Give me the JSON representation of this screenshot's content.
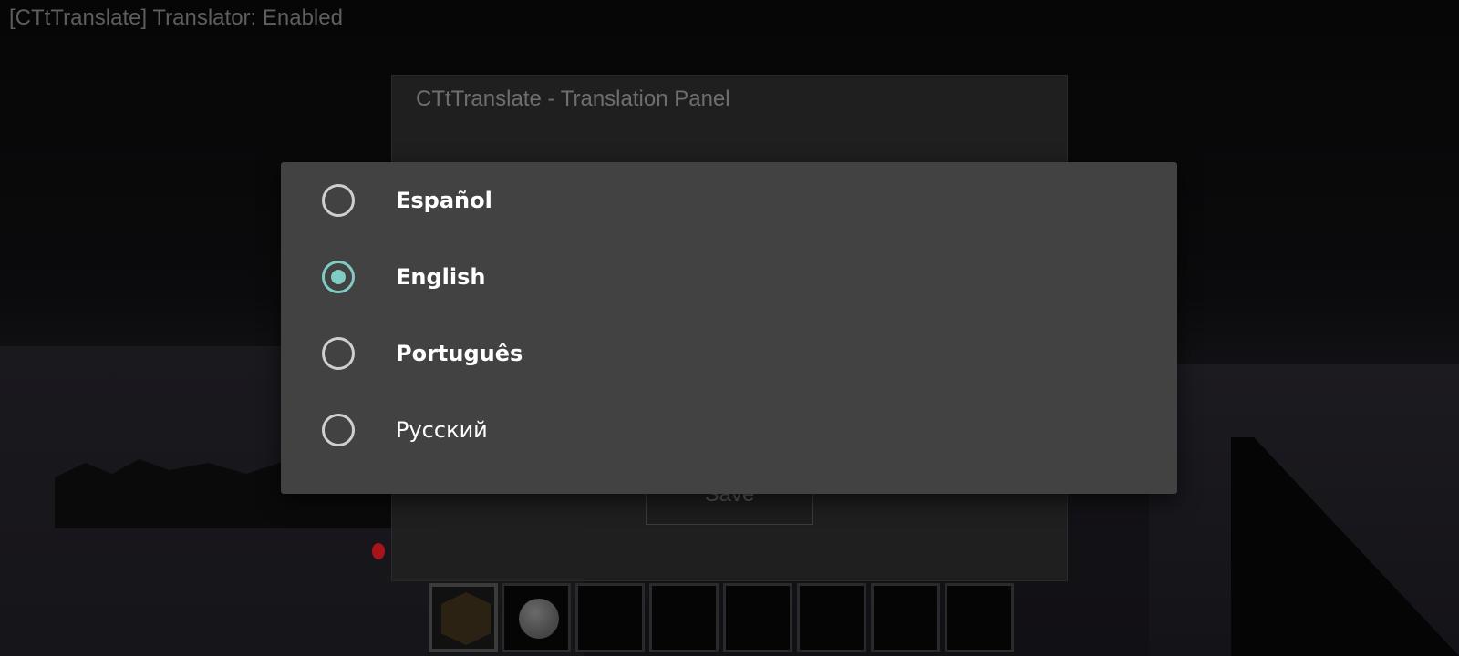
{
  "status_bar": {
    "text": "[CTtTranslate] Translator: Enabled"
  },
  "panel": {
    "title": "CTtTranslate - Translation Panel",
    "save_label": "Save"
  },
  "language_dialog": {
    "selected": "English",
    "accent_color": "#80cbc4",
    "options": [
      {
        "label": "Español",
        "checked": false
      },
      {
        "label": "English",
        "checked": true
      },
      {
        "label": "Português",
        "checked": false
      },
      {
        "label": "Русский",
        "checked": false
      }
    ]
  },
  "hotbar": {
    "slot_count": 8,
    "selected_slot": 1,
    "items": [
      "dirt-block-icon",
      "snowball-icon"
    ]
  }
}
